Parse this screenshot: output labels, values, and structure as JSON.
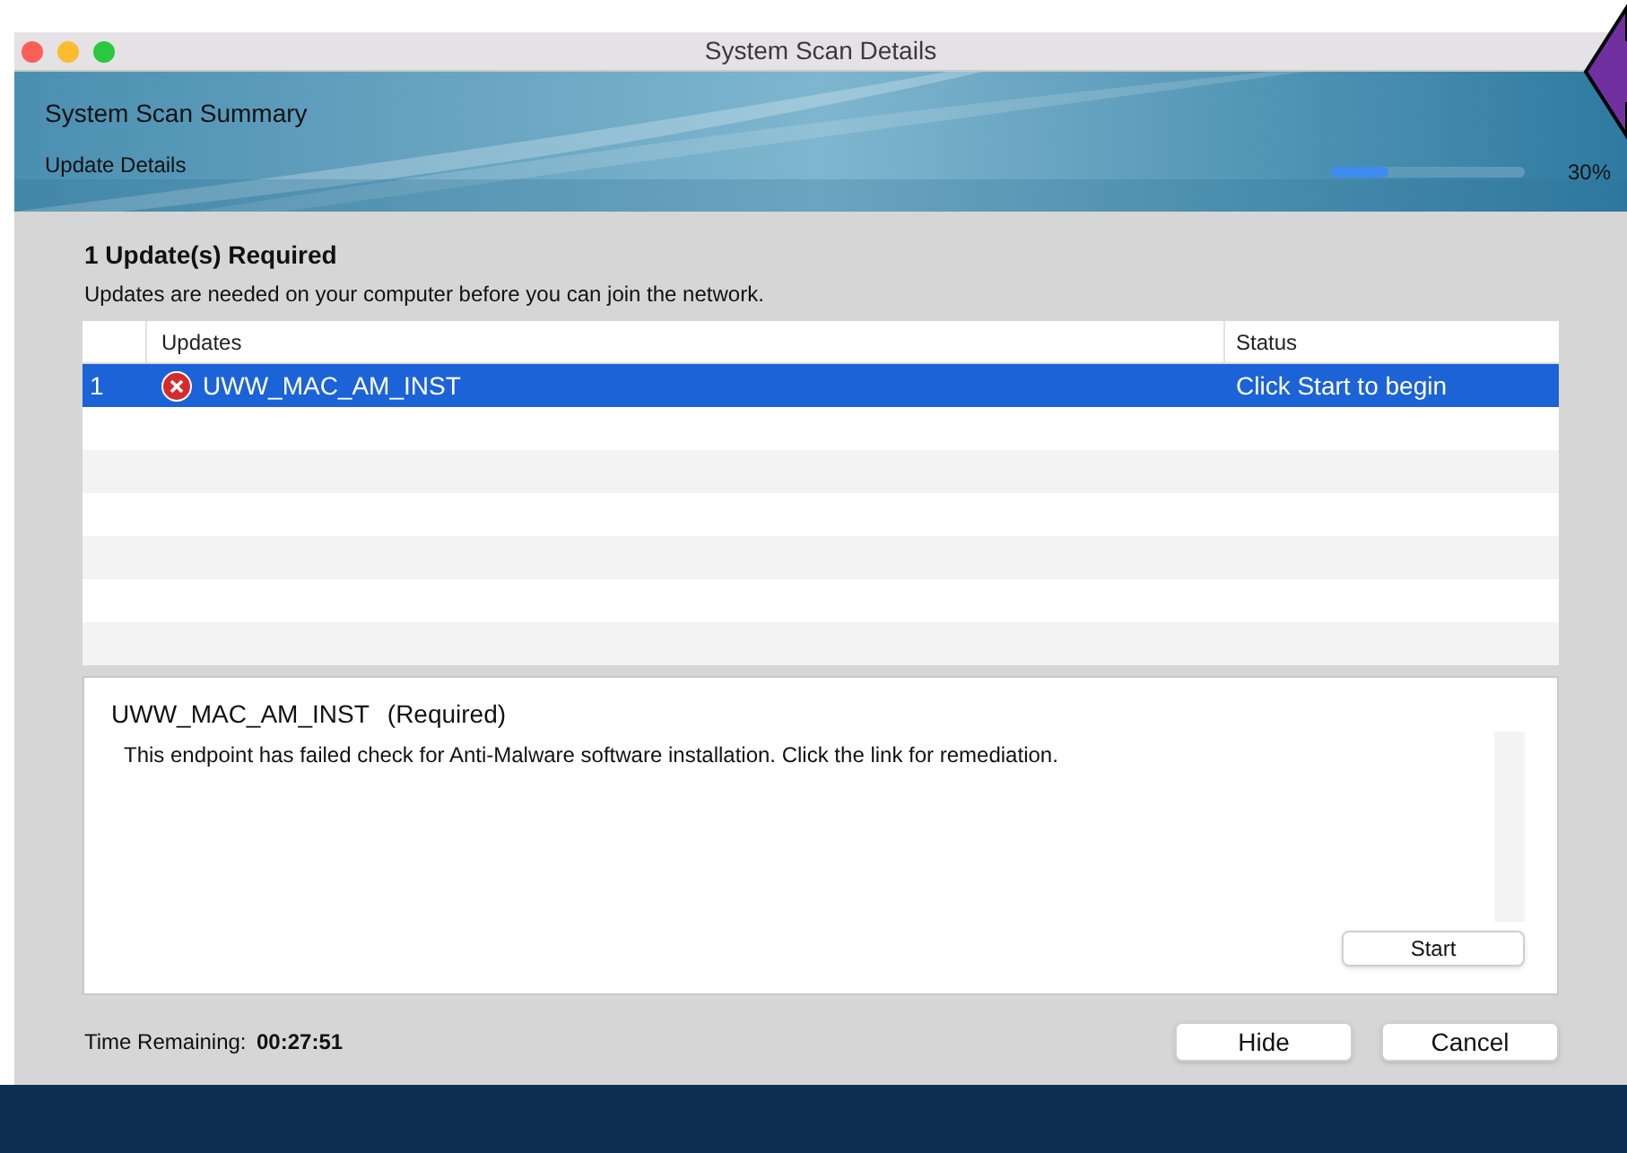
{
  "window": {
    "title": "System Scan Details"
  },
  "header": {
    "title": "System Scan Summary",
    "subtitle": "Update Details",
    "progress": {
      "level": 0.3,
      "reading": "30%"
    }
  },
  "summary": {
    "title": "1 Update(s) Required",
    "message": "Updates are needed on your computer before you can join the network."
  },
  "table": {
    "columns": [
      "Updates",
      "Status"
    ],
    "rows": [
      {
        "number": "1",
        "name": "UWW_MAC_AM_INST",
        "status": "Click Start to begin",
        "selected": true,
        "failed": true
      }
    ]
  },
  "details": {
    "name": "UWW_MAC_AM_INST",
    "requirement": "(Required)",
    "message": "This endpoint has failed check for Anti-Malware software installation.  Click the link for remediation.",
    "button": "Start"
  },
  "footer": {
    "label": "Time Remaining:",
    "time": "00:27:51",
    "buttons": [
      "Hide",
      "Cancel"
    ]
  }
}
